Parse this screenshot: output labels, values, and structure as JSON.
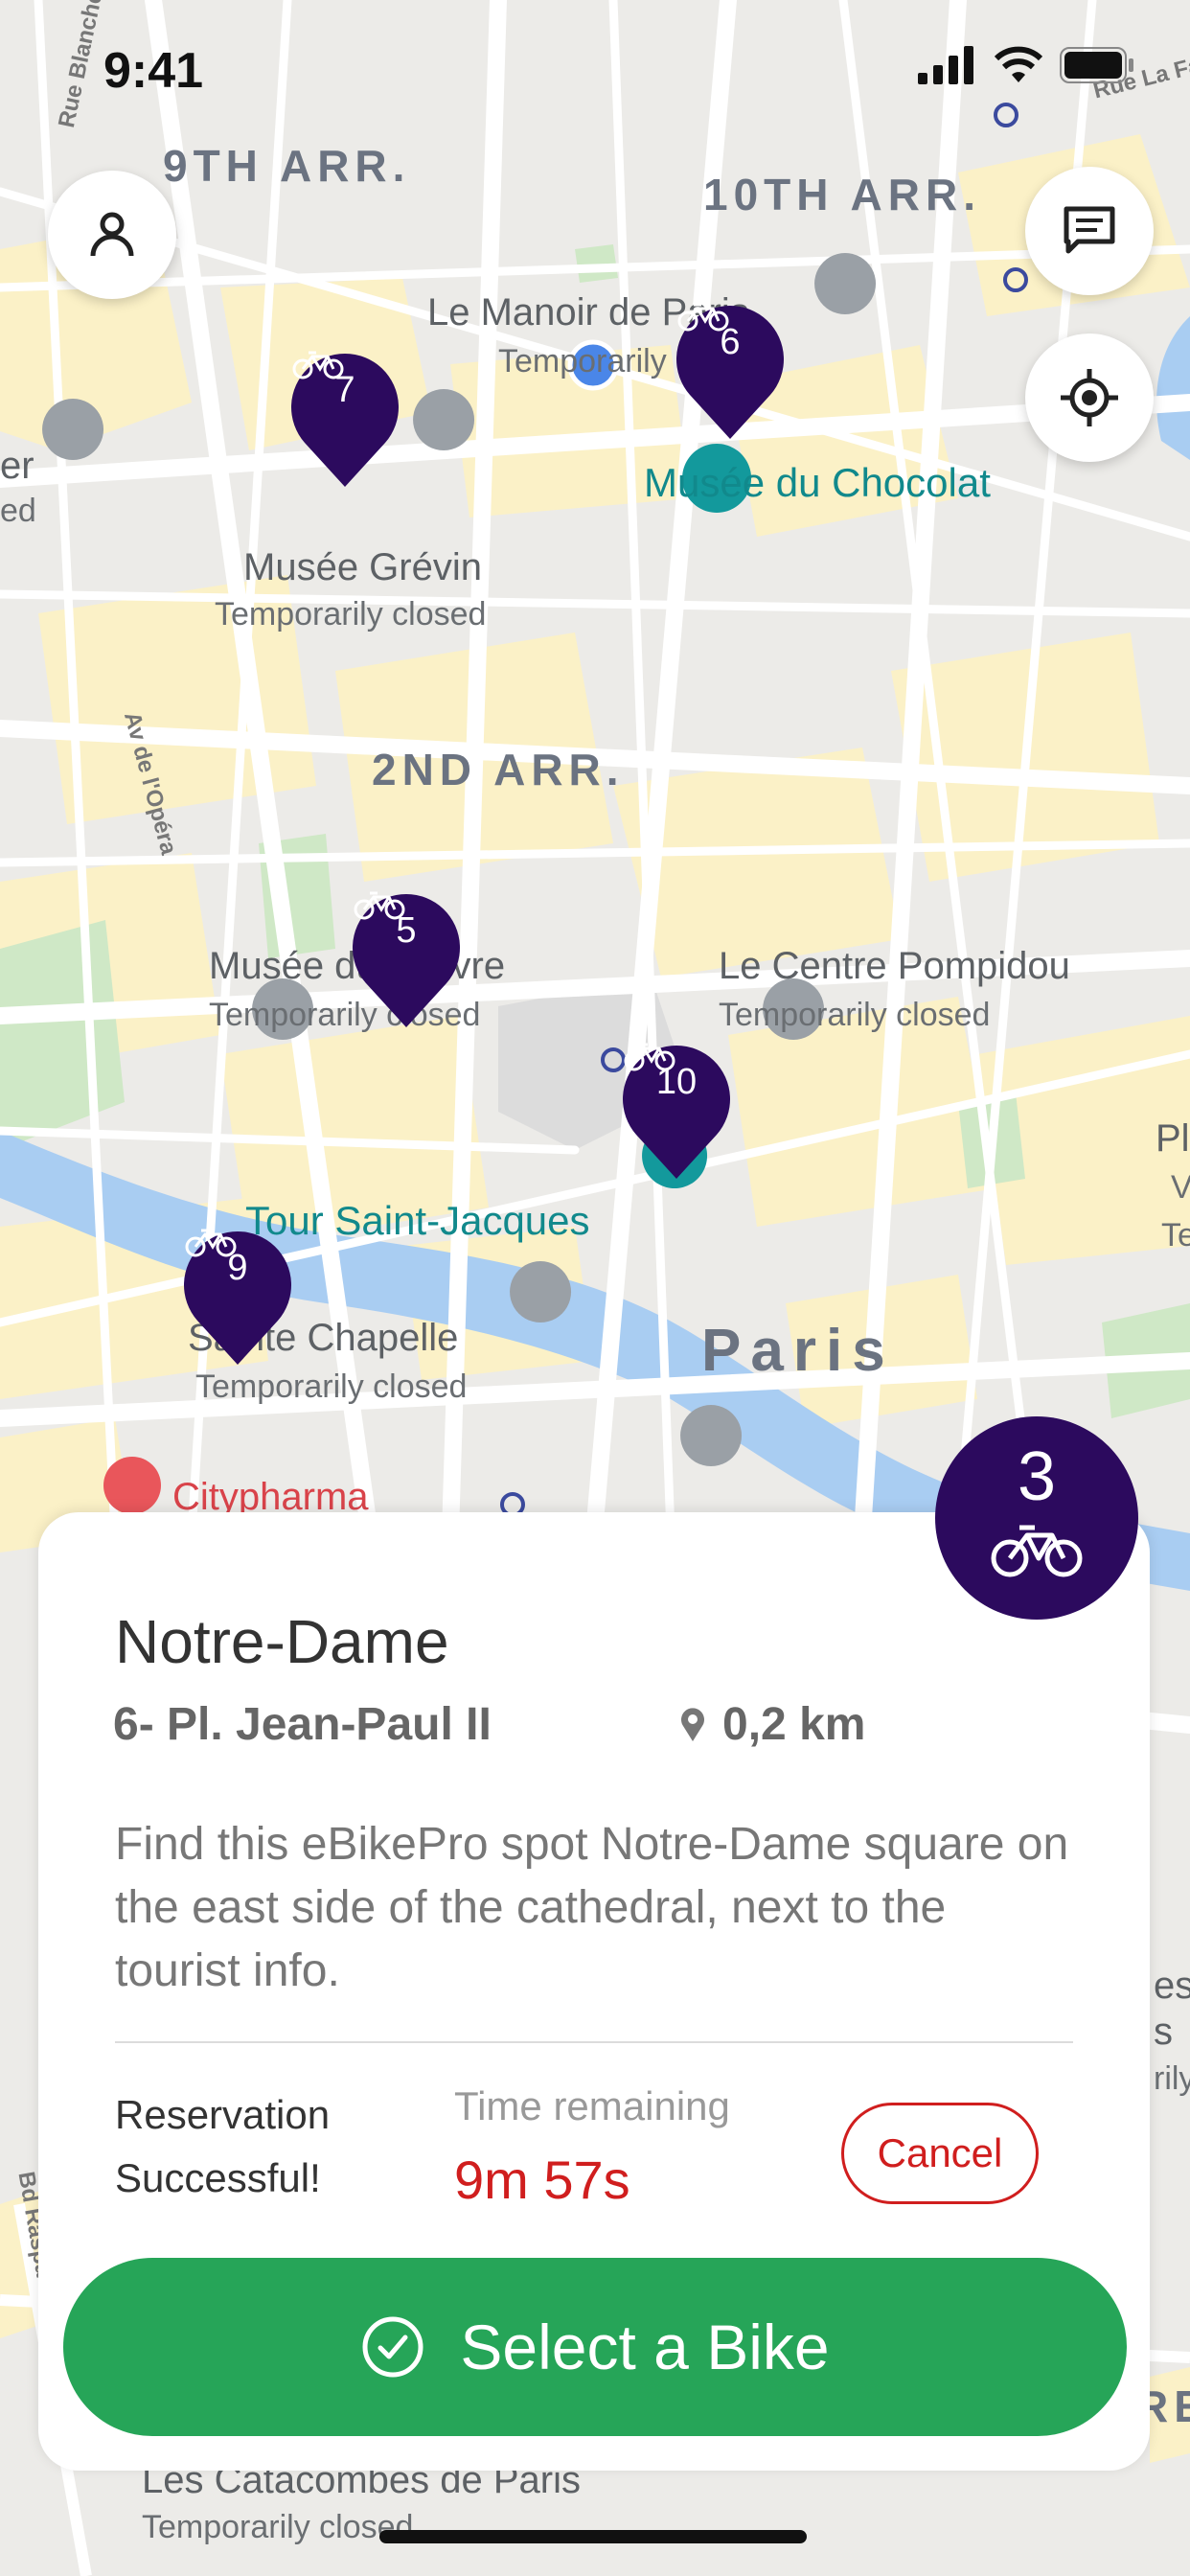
{
  "status_bar": {
    "time": "9:41"
  },
  "map": {
    "areas": [
      "9TH ARR.",
      "10TH ARR.",
      "2ND ARR.",
      "Paris"
    ],
    "streets": [
      "Rue Blanche",
      "Av de l'Opéra",
      "Rue La Fa",
      "Bd Raspa"
    ],
    "places": [
      {
        "name": "Le Manoir de Paris",
        "status": "Temporarily closed"
      },
      {
        "name": "Musée du Chocolat"
      },
      {
        "name": "Musée Grévin",
        "status": "Temporarily closed"
      },
      {
        "name": "Musée du Louvre",
        "status": "Temporarily closed"
      },
      {
        "name": "Le Centre Pompidou",
        "status": "Temporarily closed"
      },
      {
        "name": "Tour Saint-Jacques"
      },
      {
        "name": "Sainte Chapelle",
        "status": "Temporarily closed"
      },
      {
        "name": "Citypharma"
      },
      {
        "name": "Les Catacombes de Paris",
        "status": "Temporarily closed"
      }
    ],
    "edge_labels": [
      "er",
      "ed",
      "Pl",
      "V",
      "Te",
      "es",
      "s",
      "rily",
      "RE"
    ]
  },
  "stations": [
    {
      "count": "7"
    },
    {
      "count": "6"
    },
    {
      "count": "5"
    },
    {
      "count": "10"
    },
    {
      "count": "9"
    }
  ],
  "selected_station": {
    "count": "3",
    "name": "Notre-Dame",
    "address": "6- Pl. Jean-Paul II",
    "distance": "0,2 km",
    "description": "Find this eBikePro spot Notre-Dame square on the east side of the cathedral, next to the tourist info."
  },
  "reservation": {
    "status": "Reservation Successful!",
    "time_label": "Time remaining",
    "time_value": "9m 57s",
    "cancel_label": "Cancel"
  },
  "select_button": {
    "label": "Select a Bike"
  },
  "colors": {
    "accent_purple": "#2c0a5e",
    "cancel_red": "#d01e1e",
    "primary_green": "#26a558",
    "poi_teal": "#11898c"
  }
}
